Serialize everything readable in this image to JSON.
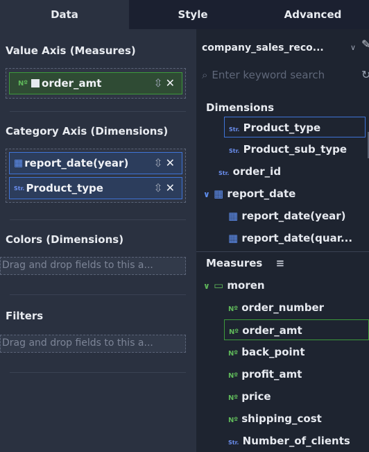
{
  "tabs": [
    "Data",
    "Style",
    "Advanced"
  ],
  "left": {
    "value_axis": {
      "title": "Value Axis (Measures)",
      "field": {
        "type": "Nº",
        "name": "order_amt"
      }
    },
    "category_axis": {
      "title": "Category Axis (Dimensions)",
      "fields": [
        {
          "type": "calendar",
          "name": "report_date(year)"
        },
        {
          "type": "Str.",
          "name": "Product_type"
        }
      ]
    },
    "colors": {
      "title": "Colors (Dimensions)",
      "placeholder": "Drag and drop fields to this a..."
    },
    "filters": {
      "title": "Filters",
      "placeholder": "Drag and drop fields to this a..."
    }
  },
  "right": {
    "dataset": "company_sales_reco...",
    "search_placeholder": "Enter keyword search",
    "dimensions_title": "Dimensions",
    "dimensions": [
      {
        "type": "Str.",
        "name": "Product_type"
      },
      {
        "type": "Str.",
        "name": "Product_sub_type"
      },
      {
        "type": "Str.",
        "name": "order_id"
      },
      {
        "type": "calendar",
        "name": "report_date"
      },
      {
        "type": "calendar",
        "name": "report_date(year)"
      },
      {
        "type": "calendar",
        "name": "report_date(quar..."
      }
    ],
    "measures_title": "Measures",
    "folder": "moren",
    "measures": [
      {
        "type": "Nº",
        "name": "order_number"
      },
      {
        "type": "Nº",
        "name": "order_amt"
      },
      {
        "type": "Nº",
        "name": "back_point"
      },
      {
        "type": "Nº",
        "name": "profit_amt"
      },
      {
        "type": "Nº",
        "name": "price"
      },
      {
        "type": "Nº",
        "name": "shipping_cost"
      },
      {
        "type": "Str.",
        "name": "Number_of_clients"
      }
    ]
  }
}
